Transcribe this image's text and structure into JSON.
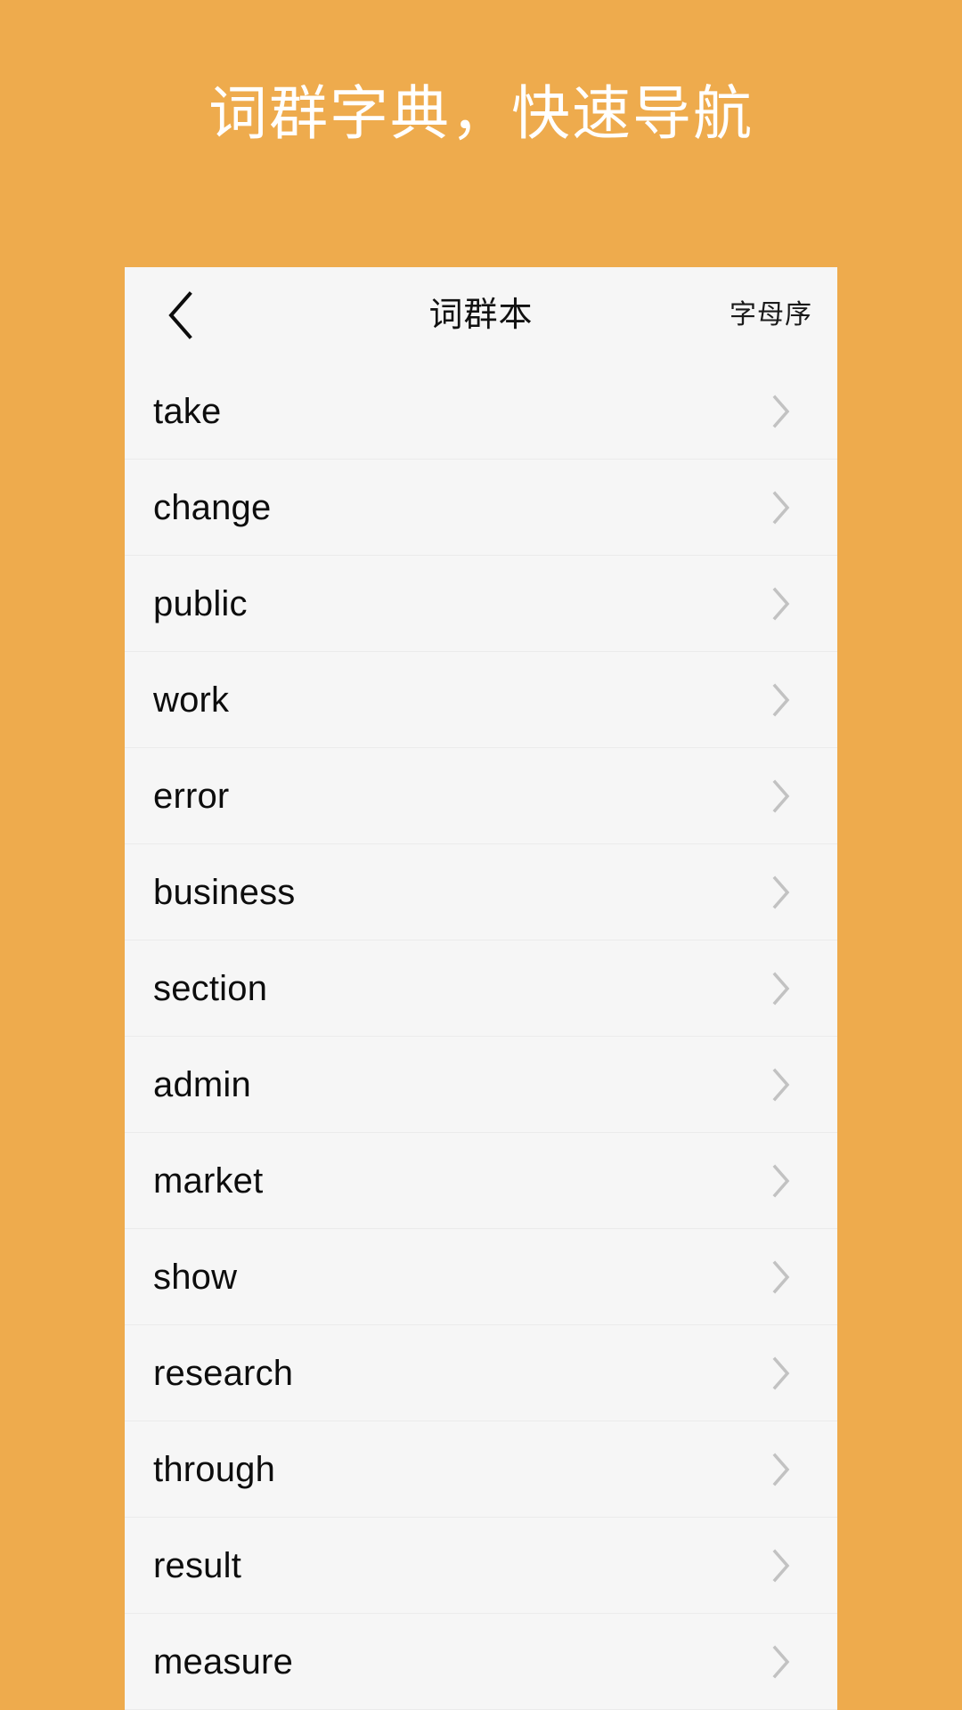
{
  "page": {
    "background_color": "#eeab4d",
    "headline": "词群字典，快速导航"
  },
  "card": {
    "background_color": "#f6f6f6",
    "navbar": {
      "back_icon": "chevron-left-icon",
      "title": "词群本",
      "action_label": "字母序"
    },
    "list": {
      "chevron_icon": "chevron-right-icon",
      "chevron_color": "#c2c2c2",
      "items": [
        {
          "label": "take"
        },
        {
          "label": "change"
        },
        {
          "label": "public"
        },
        {
          "label": "work"
        },
        {
          "label": "error"
        },
        {
          "label": "business"
        },
        {
          "label": "section"
        },
        {
          "label": "admin"
        },
        {
          "label": "market"
        },
        {
          "label": "show"
        },
        {
          "label": "research"
        },
        {
          "label": "through"
        },
        {
          "label": "result"
        },
        {
          "label": "measure"
        }
      ]
    }
  }
}
